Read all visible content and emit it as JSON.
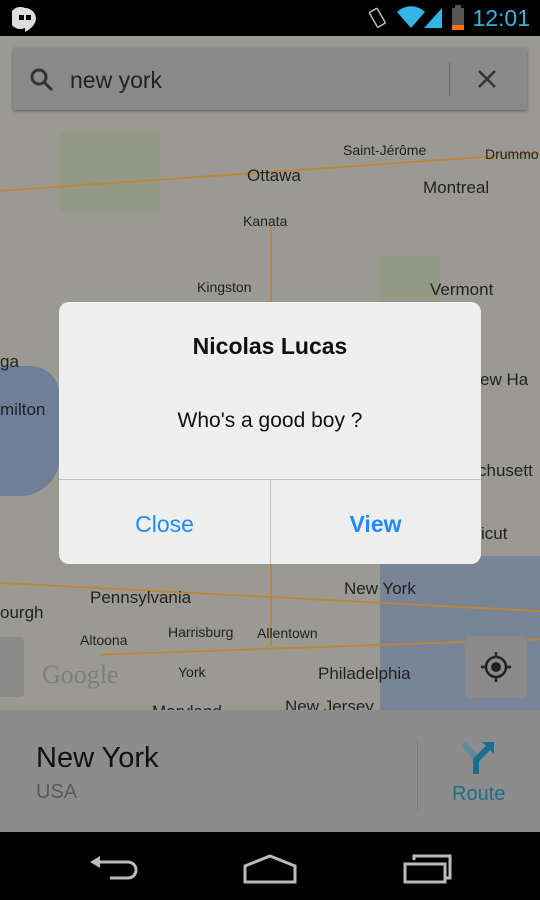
{
  "status_bar": {
    "time": "12:01",
    "icons": [
      "hangouts-icon",
      "vibrate-icon",
      "wifi-icon",
      "signal-icon",
      "battery-low-icon"
    ],
    "accent": "#33b5e5"
  },
  "search": {
    "query": "new york",
    "icons": [
      "search-icon",
      "clear-icon"
    ]
  },
  "map": {
    "labels": [
      {
        "text": "Ottawa",
        "cls": ""
      },
      {
        "text": "Saint-Jérôme",
        "cls": "sm"
      },
      {
        "text": "Drummo",
        "cls": "sm"
      },
      {
        "text": "Montreal",
        "cls": ""
      },
      {
        "text": "Kanata",
        "cls": "sm"
      },
      {
        "text": "Kingston",
        "cls": "sm"
      },
      {
        "text": "Vermont",
        "cls": ""
      },
      {
        "text": "New York",
        "cls": ""
      },
      {
        "text": "Pennsylvania",
        "cls": ""
      },
      {
        "text": "Harrisburg",
        "cls": "sm"
      },
      {
        "text": "Allentown",
        "cls": "sm"
      },
      {
        "text": "Altoona",
        "cls": "sm"
      },
      {
        "text": "York",
        "cls": "sm"
      },
      {
        "text": "Philadelphia",
        "cls": ""
      },
      {
        "text": "Maryland",
        "cls": ""
      },
      {
        "text": "New Jersey",
        "cls": ""
      },
      {
        "text": "ew Ha",
        "cls": ""
      },
      {
        "text": "chusett",
        "cls": ""
      },
      {
        "text": "icut",
        "cls": ""
      },
      {
        "text": "ourgh",
        "cls": ""
      },
      {
        "text": "milton",
        "cls": ""
      },
      {
        "text": "ga",
        "cls": ""
      }
    ],
    "watermark": "Google"
  },
  "dialog": {
    "title": "Nicolas Lucas",
    "message": "Who's a good boy ?",
    "close_label": "Close",
    "view_label": "View"
  },
  "place_card": {
    "name": "New York",
    "country": "USA",
    "route_label": "Route",
    "route_color": "#1a6f8c"
  },
  "nav": {
    "icons": [
      "back-icon",
      "home-icon",
      "recents-icon"
    ]
  }
}
